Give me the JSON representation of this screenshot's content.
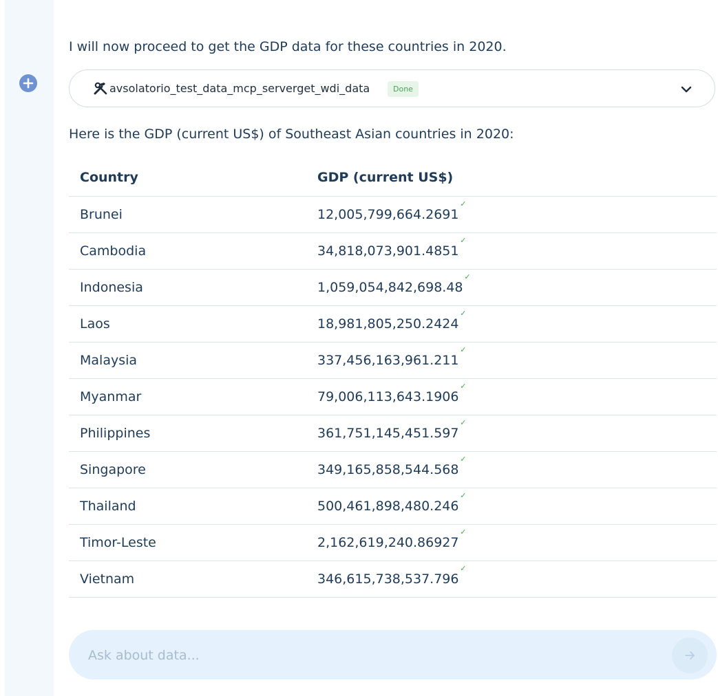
{
  "message": {
    "intro": "I will now proceed to get the GDP data for these countries in 2020.",
    "tool_call": {
      "icon": "hammer-wrench-icon",
      "name": "avsolatorio_test_data_mcp_serverget_wdi_data",
      "status": "Done",
      "expand_icon": "chevron-down-icon"
    },
    "summary": "Here is the GDP (current US$) of Southeast Asian countries in 2020:"
  },
  "table": {
    "headers": [
      "Country",
      "GDP (current US$)"
    ],
    "verified_mark": "✓",
    "rows": [
      {
        "country": "Brunei",
        "gdp": "12,005,799,664.2691"
      },
      {
        "country": "Cambodia",
        "gdp": "34,818,073,901.4851"
      },
      {
        "country": "Indonesia",
        "gdp": "1,059,054,842,698.48"
      },
      {
        "country": "Laos",
        "gdp": "18,981,805,250.2424"
      },
      {
        "country": "Malaysia",
        "gdp": "337,456,163,961.211"
      },
      {
        "country": "Myanmar",
        "gdp": "79,006,113,643.1906"
      },
      {
        "country": "Philippines",
        "gdp": "361,751,145,451.597"
      },
      {
        "country": "Singapore",
        "gdp": "349,165,858,544.568"
      },
      {
        "country": "Thailand",
        "gdp": "500,461,898,480.246"
      },
      {
        "country": "Timor-Leste",
        "gdp": "2,162,619,240.86927"
      },
      {
        "country": "Vietnam",
        "gdp": "346,615,738,537.796"
      }
    ]
  },
  "chat": {
    "placeholder": "Ask about data...",
    "send_icon": "arrow-right-icon"
  },
  "sidebar": {
    "add_icon": "plus-circle-icon"
  },
  "colors": {
    "text": "#1f3b57",
    "accent": "#6f93d2",
    "done_bg": "#e7f5e9",
    "done_text": "#4aa354",
    "chat_bg": "#e5f1fc"
  }
}
